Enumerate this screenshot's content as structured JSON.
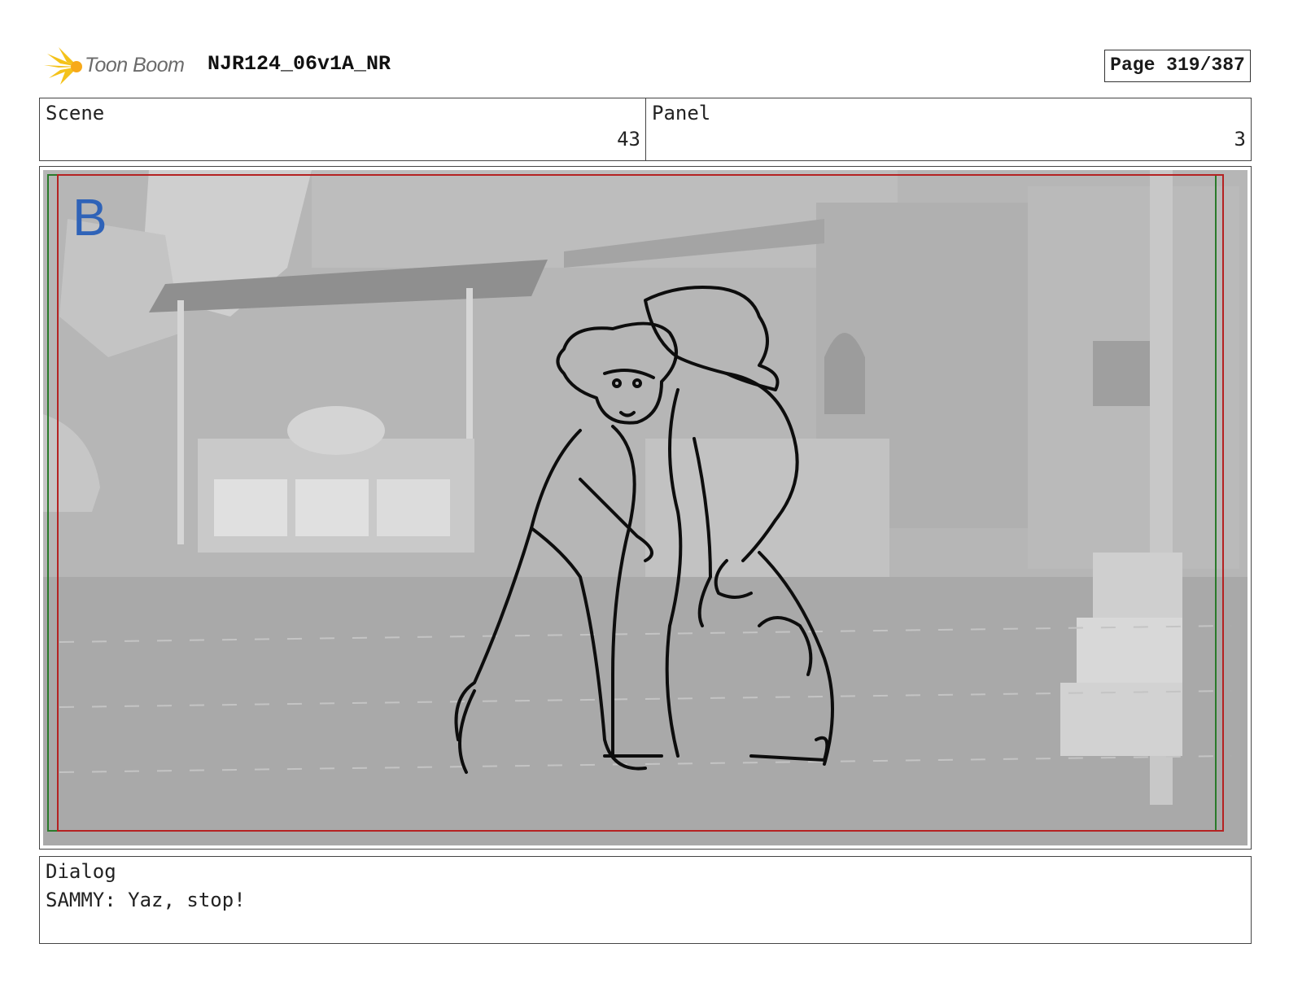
{
  "header": {
    "logo_text": "Toon Boom",
    "doc_title": "NJR124_06v1A_NR",
    "page_label": "Page 319/387"
  },
  "scene": {
    "label": "Scene",
    "value": "43"
  },
  "panel": {
    "label": "Panel",
    "value": "3"
  },
  "image": {
    "layer_mark": "B",
    "layer_mark_color": "#2f63b8",
    "safe_frame_color": "#b52222",
    "field_frame_color": "#2a7a2a"
  },
  "dialog": {
    "label": "Dialog",
    "text": "SAMMY: Yaz, stop!"
  }
}
